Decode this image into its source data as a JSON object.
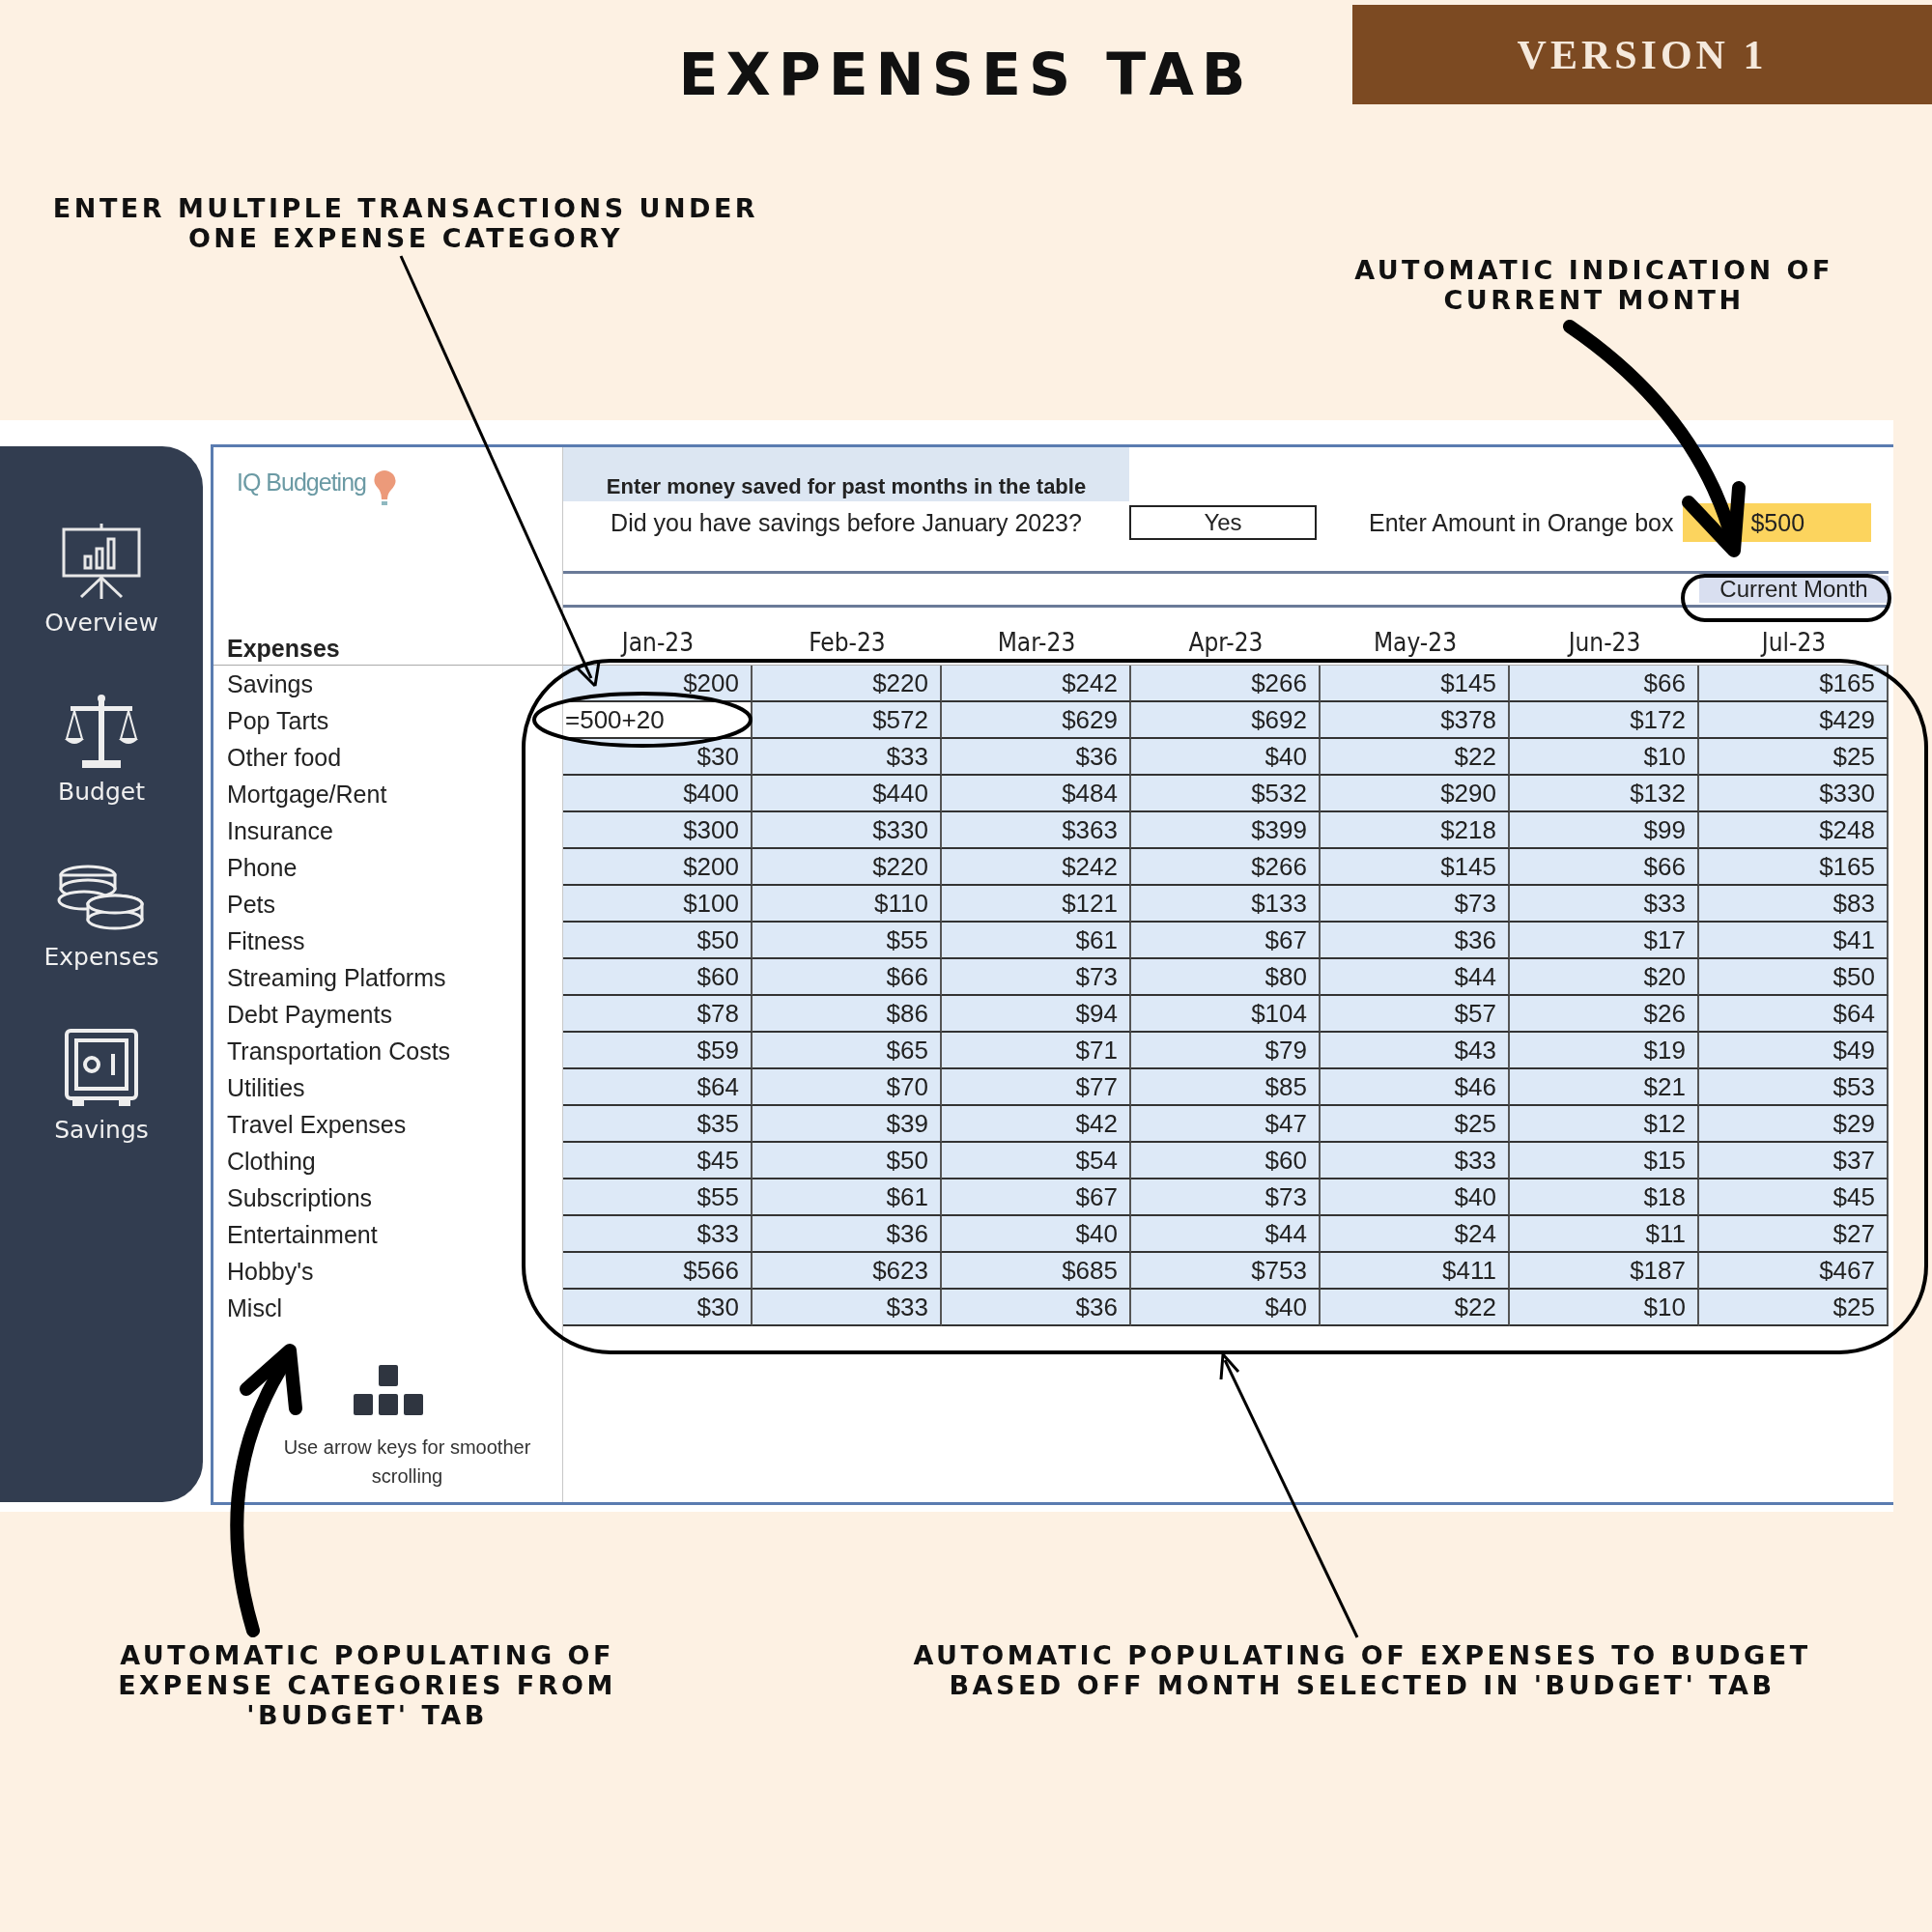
{
  "title": "EXPENSES TAB",
  "version": "VERSION 1",
  "annotations_top": [
    "ENTER MULTIPLE TRANSACTIONS UNDER ONE EXPENSE CATEGORY",
    "AUTOMATIC INDICATION OF CURRENT MONTH"
  ],
  "annotations_bottom": [
    "AUTOMATIC POPULATING OF EXPENSE CATEGORIES FROM 'BUDGET' TAB",
    "AUTOMATIC POPULATING OF EXPENSES TO BUDGET BASED OFF MONTH SELECTED IN 'BUDGET' TAB"
  ],
  "sidebar": {
    "items": [
      {
        "label": "Overview",
        "kind": "overview"
      },
      {
        "label": "Budget",
        "kind": "budget"
      },
      {
        "label": "Expenses",
        "kind": "expenses"
      },
      {
        "label": "Savings",
        "kind": "savings"
      }
    ]
  },
  "sheet": {
    "logo": "IQ Budgeting",
    "savings_heading": "Enter money saved for past months in the table",
    "savings_question": "Did you have savings before January 2023?",
    "savings_answer": "Yes",
    "amount_prompt": "Enter Amount in Orange box",
    "amount": "$500",
    "current_month_label": "Current Month",
    "row_header": "Expenses",
    "columns": [
      {
        "label": "Jan-23",
        "current": false
      },
      {
        "label": "Feb-23",
        "current": false
      },
      {
        "label": "Mar-23",
        "current": false
      },
      {
        "label": "Apr-23",
        "current": false
      },
      {
        "label": "May-23",
        "current": false
      },
      {
        "label": "Jun-23",
        "current": false
      },
      {
        "label": "Jul-23",
        "current": true
      }
    ],
    "rows": [
      {
        "name": "Savings",
        "editing": false,
        "values": [
          "$200",
          "$220",
          "$242",
          "$266",
          "$145",
          "$66",
          "$165"
        ]
      },
      {
        "name": "Pop Tarts",
        "editing": true,
        "values": [
          "=500+20",
          "$572",
          "$629",
          "$692",
          "$378",
          "$172",
          "$429"
        ]
      },
      {
        "name": "Other food",
        "editing": false,
        "values": [
          "$30",
          "$33",
          "$36",
          "$40",
          "$22",
          "$10",
          "$25"
        ]
      },
      {
        "name": "Mortgage/Rent",
        "editing": false,
        "values": [
          "$400",
          "$440",
          "$484",
          "$532",
          "$290",
          "$132",
          "$330"
        ]
      },
      {
        "name": "Insurance",
        "editing": false,
        "values": [
          "$300",
          "$330",
          "$363",
          "$399",
          "$218",
          "$99",
          "$248"
        ]
      },
      {
        "name": "Phone",
        "editing": false,
        "values": [
          "$200",
          "$220",
          "$242",
          "$266",
          "$145",
          "$66",
          "$165"
        ]
      },
      {
        "name": "Pets",
        "editing": false,
        "values": [
          "$100",
          "$110",
          "$121",
          "$133",
          "$73",
          "$33",
          "$83"
        ]
      },
      {
        "name": "Fitness",
        "editing": false,
        "values": [
          "$50",
          "$55",
          "$61",
          "$67",
          "$36",
          "$17",
          "$41"
        ]
      },
      {
        "name": "Streaming Platforms",
        "editing": false,
        "values": [
          "$60",
          "$66",
          "$73",
          "$80",
          "$44",
          "$20",
          "$50"
        ]
      },
      {
        "name": "Debt Payments",
        "editing": false,
        "values": [
          "$78",
          "$86",
          "$94",
          "$104",
          "$57",
          "$26",
          "$64"
        ]
      },
      {
        "name": "Transportation Costs",
        "editing": false,
        "values": [
          "$59",
          "$65",
          "$71",
          "$79",
          "$43",
          "$19",
          "$49"
        ]
      },
      {
        "name": "Utilities",
        "editing": false,
        "values": [
          "$64",
          "$70",
          "$77",
          "$85",
          "$46",
          "$21",
          "$53"
        ]
      },
      {
        "name": "Travel Expenses",
        "editing": false,
        "values": [
          "$35",
          "$39",
          "$42",
          "$47",
          "$25",
          "$12",
          "$29"
        ]
      },
      {
        "name": "Clothing",
        "editing": false,
        "values": [
          "$45",
          "$50",
          "$54",
          "$60",
          "$33",
          "$15",
          "$37"
        ]
      },
      {
        "name": "Subscriptions",
        "editing": false,
        "values": [
          "$55",
          "$61",
          "$67",
          "$73",
          "$40",
          "$18",
          "$45"
        ]
      },
      {
        "name": "Entertainment",
        "editing": false,
        "values": [
          "$33",
          "$36",
          "$40",
          "$44",
          "$24",
          "$11",
          "$27"
        ]
      },
      {
        "name": "Hobby's",
        "editing": false,
        "values": [
          "$566",
          "$623",
          "$685",
          "$753",
          "$411",
          "$187",
          "$467"
        ]
      },
      {
        "name": "Miscl",
        "editing": false,
        "values": [
          "$30",
          "$33",
          "$36",
          "$40",
          "$22",
          "$10",
          "$25"
        ]
      }
    ],
    "hint": "Use arrow keys for smoother scrolling"
  }
}
